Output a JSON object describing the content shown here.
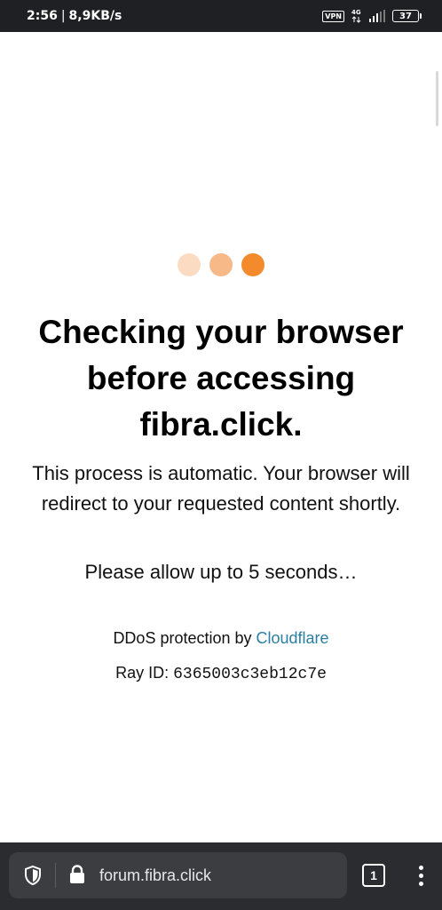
{
  "status_bar": {
    "time": "2:56",
    "separator": "|",
    "net_speed": "8,9KB/s",
    "vpn": "VPN",
    "network_type": "4G",
    "battery": "37"
  },
  "page": {
    "heading": "Checking your browser before accessing fibra.click.",
    "description": "This process is automatic. Your browser will redirect to your requested content shortly.",
    "allow_text": "Please allow up to 5 seconds…",
    "ddos_prefix": "DDoS protection by ",
    "ddos_link": "Cloudflare",
    "ray_label": "Ray ID: ",
    "ray_id": "6365003c3eb12c7e"
  },
  "loader": {
    "colors": [
      "#fbdcc2",
      "#f6b987",
      "#f38b2c"
    ]
  },
  "browser_bar": {
    "url": "forum.fibra.click",
    "tab_count": "1",
    "icons": [
      "shield-icon",
      "lock-icon",
      "tabs-icon",
      "more-vert-icon"
    ]
  },
  "colors": {
    "accent": "#f38b2c",
    "link": "#2a7fa3",
    "status_bar_bg": "#1f2023",
    "bottom_bar_bg": "#2b2c30"
  }
}
